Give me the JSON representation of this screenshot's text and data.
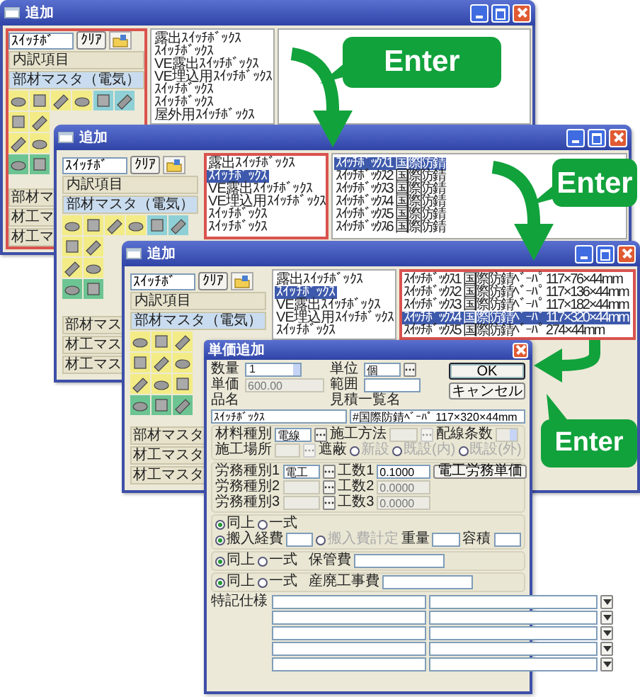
{
  "windows": [
    {
      "title": "追加",
      "search_pane": {
        "focused": true
      },
      "search": {
        "value": "ｽｲｯﾁﾎﾞ"
      },
      "clear_button": "ｸﾘｱ",
      "categories": [
        {
          "label": "内訳項目",
          "selected": false
        },
        {
          "label": "部材マスタ（電気）",
          "selected": true
        }
      ],
      "masters": [
        "部材マ",
        "材工マ",
        "材工マ"
      ],
      "middle_list": {
        "focused": false,
        "items": [
          {
            "label": "露出ｽｲｯﾁﾎﾞｯｸｽ",
            "selected": false
          },
          {
            "label": "ｽｲｯﾁﾎﾞｯｸｽ",
            "selected": false
          },
          {
            "label": "VE露出ｽｲｯﾁﾎﾞｯｸｽ",
            "selected": false
          },
          {
            "label": "VE埋込用ｽｲｯﾁﾎﾞｯｸｽ",
            "selected": false
          },
          {
            "label": "ｽｲｯﾁﾎﾞｯｸｽ",
            "selected": false
          },
          {
            "label": "ｽｲｯﾁﾎﾞｯｸｽ",
            "selected": false
          },
          {
            "label": "屋外用ｽｲｯﾁﾎﾞｯｸｽ",
            "selected": false
          }
        ]
      },
      "right_list": {
        "focused": false
      }
    },
    {
      "title": "追加",
      "search_pane": {
        "focused": false
      },
      "search": {
        "value": "ｽｲｯﾁﾎﾞ"
      },
      "clear_button": "ｸﾘｱ",
      "categories": [
        {
          "label": "内訳項目",
          "selected": false
        },
        {
          "label": "部材マスタ（電気）",
          "selected": true
        }
      ],
      "masters": [
        "部材マス",
        "材工マス",
        "材工マス"
      ],
      "middle_list": {
        "focused": true,
        "items": [
          {
            "label": "露出ｽｲｯﾁﾎﾞｯｸｽ",
            "selected": false
          },
          {
            "label": "ｽｲｯﾁﾎﾞｯｸｽ",
            "selected": true
          },
          {
            "label": "VE露出ｽｲｯﾁﾎﾞｯｸｽ",
            "selected": false
          },
          {
            "label": "VE埋込用ｽｲｯﾁﾎﾞｯｸｽ",
            "selected": false
          },
          {
            "label": "ｽｲｯﾁﾎﾞｯｸｽ",
            "selected": false
          },
          {
            "label": "ｽｲｯﾁﾎﾞｯｸｽ",
            "selected": false
          }
        ]
      },
      "right_list": {
        "focused": false,
        "items": [
          {
            "label": "ｽｲｯﾁﾎﾞｯｸｽ1 国際防錆",
            "selected": true
          },
          {
            "label": "ｽｲｯﾁﾎﾞｯｸｽ2 国際防錆",
            "selected": false
          },
          {
            "label": "ｽｲｯﾁﾎﾞｯｸｽ3 国際防錆",
            "selected": false
          },
          {
            "label": "ｽｲｯﾁﾎﾞｯｸｽ4 国際防錆",
            "selected": false
          },
          {
            "label": "ｽｲｯﾁﾎﾞｯｸｽ5 国際防錆",
            "selected": false
          },
          {
            "label": "ｽｲｯﾁﾎﾞｯｸｽ6 国際防錆",
            "selected": false
          }
        ]
      }
    },
    {
      "title": "追加",
      "search_pane": {
        "focused": false
      },
      "search": {
        "value": "ｽｲｯﾁﾎﾞ"
      },
      "clear_button": "ｸﾘｱ",
      "categories": [
        {
          "label": "内訳項目",
          "selected": false
        },
        {
          "label": "部材マスタ（電気）",
          "selected": true
        }
      ],
      "masters": [
        "部材マスタ",
        "材工マスタ",
        "材工マスタ"
      ],
      "middle_list": {
        "focused": false,
        "items": [
          {
            "label": "露出ｽｲｯﾁﾎﾞｯｸｽ",
            "selected": false
          },
          {
            "label": "ｽｲｯﾁﾎﾞｯｸｽ",
            "selected": true
          },
          {
            "label": "VE露出ｽｲｯﾁﾎﾞｯｸｽ",
            "selected": false
          },
          {
            "label": "VE埋込用ｽｲｯﾁﾎﾞｯｸｽ",
            "selected": false
          },
          {
            "label": "ｽｲｯﾁﾎﾞｯｸｽ",
            "selected": false
          }
        ]
      },
      "right_list": {
        "focused": true,
        "items": [
          {
            "label": "ｽｲｯﾁﾎﾞｯｸｽ1 国際防錆ﾍﾞｰﾊﾟ 117×76×44mm",
            "selected": false
          },
          {
            "label": "ｽｲｯﾁﾎﾞｯｸｽ2 国際防錆ﾍﾞｰﾊﾟ 117×136×44mm",
            "selected": false
          },
          {
            "label": "ｽｲｯﾁﾎﾞｯｸｽ3 国際防錆ﾍﾞｰﾊﾟ 117×182×44mm",
            "selected": false
          },
          {
            "label": "ｽｲｯﾁﾎﾞｯｸｽ4 国際防錆ﾍﾞｰﾊﾟ 117×320×44mm",
            "selected": true
          },
          {
            "label": "ｽｲｯﾁﾎﾞｯｸｽ5 国際防錆ﾍﾞｰﾊﾟ 274×44mm",
            "selected": false
          }
        ]
      }
    }
  ],
  "dialog": {
    "title": "単価追加",
    "quantity": {
      "label": "数量",
      "value": "1"
    },
    "unit": {
      "label": "単位",
      "value": "個"
    },
    "unit_price": {
      "label": "単価",
      "value": "600.00",
      "disabled": true
    },
    "range": {
      "label": "範囲"
    },
    "buttons": [
      {
        "label": "OK",
        "default": true
      },
      {
        "label": "キャンセル",
        "default": false
      }
    ],
    "name": {
      "label": "品名",
      "value": "ｽｲｯﾁﾎﾞｯｸｽ"
    },
    "estimate_name": {
      "label": "見積一覧名",
      "value": "#国際防錆ﾍﾞｰﾊﾟ 117×320×44mm"
    },
    "material": {
      "label": "材料種別",
      "value": "電線"
    },
    "method": {
      "label": "施工方法",
      "disabled": true
    },
    "wires": {
      "label": "配線条数",
      "disabled": true
    },
    "place": {
      "label": "施工場所",
      "disabled": true
    },
    "shield": {
      "label": "遮蔽",
      "options": [
        {
          "label": "新設",
          "selected": false,
          "disabled": true
        },
        {
          "label": "既設(内)",
          "selected": false,
          "disabled": true
        },
        {
          "label": "既設(外)",
          "selected": false,
          "disabled": true
        }
      ]
    },
    "labor": [
      {
        "label": "労務種別1",
        "value": "電工",
        "hours_label": "工数1",
        "hours": "0.1000",
        "disabled": false
      },
      {
        "label": "労務種別2",
        "hours_label": "工数2",
        "hours": "0.0000",
        "disabled": true
      },
      {
        "label": "労務種別3",
        "hours_label": "工数3",
        "hours": "0.0000",
        "disabled": true
      }
    ],
    "labor_button": "電工労務単価",
    "cost_groups": [
      {
        "options": [
          {
            "label": "同上",
            "selected": true
          },
          {
            "label": "一式",
            "selected": false
          }
        ],
        "row": [
          {
            "kind": "radio",
            "label": "搬入経費",
            "selected": true,
            "disabled": false
          },
          {
            "kind": "field"
          },
          {
            "kind": "radio",
            "label": "搬入費計定",
            "selected": false,
            "disabled": true
          },
          {
            "kind": "label",
            "label": "重量"
          },
          {
            "kind": "field"
          },
          {
            "kind": "label",
            "label": "容積"
          },
          {
            "kind": "field"
          }
        ]
      },
      {
        "options": [
          {
            "label": "同上",
            "selected": true
          },
          {
            "label": "一式",
            "selected": false
          }
        ],
        "row": [
          {
            "kind": "label",
            "label": "保管費"
          },
          {
            "kind": "field"
          }
        ]
      },
      {
        "options": [
          {
            "label": "同上",
            "selected": true
          },
          {
            "label": "一式",
            "selected": false
          }
        ],
        "row": [
          {
            "kind": "label",
            "label": "産廃工事費"
          },
          {
            "kind": "field"
          }
        ]
      }
    ],
    "notes_label": "特記仕様"
  },
  "callouts": [
    {
      "label": "Enter"
    },
    {
      "label": "Enter"
    },
    {
      "label": "Enter"
    }
  ]
}
